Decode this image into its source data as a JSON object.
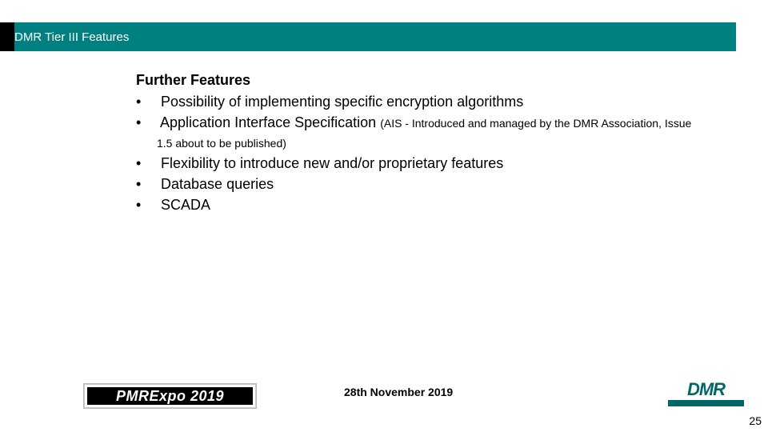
{
  "titleBar": "DMR Tier III Features",
  "sectionHeading": "Further Features",
  "bullets": [
    {
      "main": "Possibility of implementing specific encryption algorithms",
      "note": ""
    },
    {
      "main": "Application Interface Specification ",
      "note": "(AIS - Introduced and managed by the DMR Association, Issue 1.5 about to be published)"
    },
    {
      "main": "Flexibility to introduce new and/or proprietary features",
      "note": ""
    },
    {
      "main": "Database queries",
      "note": ""
    },
    {
      "main": "SCADA",
      "note": ""
    }
  ],
  "footerDate": "28th November 2019",
  "pageNumber": "25",
  "pmrLogoText": "PMRExpo 2019",
  "dmrLogoText": "DMR"
}
